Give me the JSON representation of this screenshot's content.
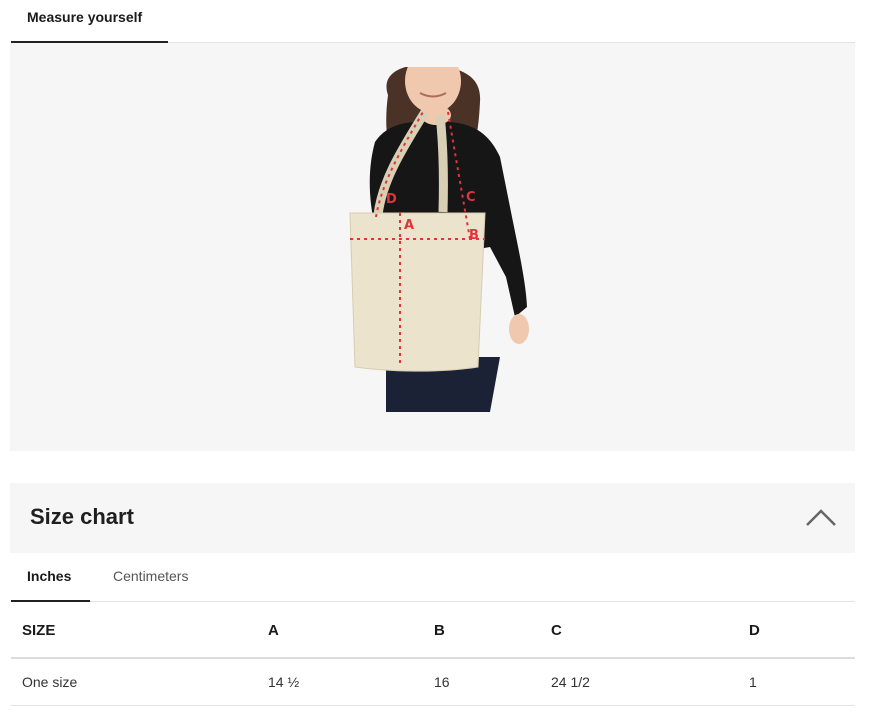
{
  "top_tab": {
    "label": "Measure yourself"
  },
  "image": {
    "markers": [
      "A",
      "B",
      "C",
      "D"
    ],
    "colors": {
      "marker": "#e0343a",
      "bag": "#ece3cc",
      "top": "#161616",
      "jeans": "#1b2236",
      "skin": "#f0c8ad",
      "hair": "#4a3226"
    }
  },
  "size_chart": {
    "title": "Size chart",
    "collapse_icon": "chevron-up-icon",
    "unit_tabs": [
      "Inches",
      "Centimeters"
    ],
    "active_unit": "Inches",
    "columns": [
      "SIZE",
      "A",
      "B",
      "C",
      "D"
    ],
    "rows": [
      [
        "One size",
        "14 ½",
        "16",
        "24 1/2",
        "1"
      ]
    ]
  }
}
